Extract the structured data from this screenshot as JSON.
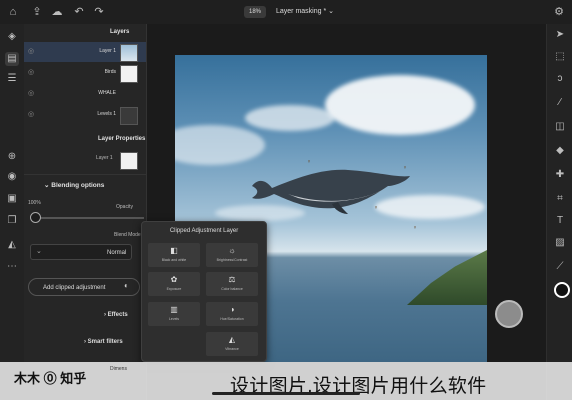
{
  "topbar": {
    "zoom": "18%",
    "title": "Layer masking",
    "title_mark": "*"
  },
  "panel": {
    "layers_title": "Layers",
    "layers": [
      {
        "name": "Layer 1",
        "thumb": "sky",
        "selected": true
      },
      {
        "name": "Birds",
        "thumb": "white",
        "selected": false
      },
      {
        "name": "WHALE",
        "thumb": "whale",
        "selected": false
      },
      {
        "name": "Levels 1",
        "thumb": "levels",
        "selected": false
      }
    ],
    "layer_props_title": "Layer Properties",
    "layer_props_name": "Layer 1",
    "blending_title": "Blending options",
    "opacity_value": "100%",
    "opacity_label": "Opacity",
    "blend_mode_label": "Blend Mode",
    "blend_mode_value": "Normal",
    "add_clipped_label": "Add clipped adjustment",
    "effects_label": "Effects",
    "smart_filters_label": "Smart filters",
    "dimensions_label": "Dimens"
  },
  "popup": {
    "title": "Clipped Adjustment Layer",
    "tiles": [
      {
        "label": "Black and white",
        "icon": "half-square-icon"
      },
      {
        "label": "Brightness/Contrast",
        "icon": "sun-icon"
      },
      {
        "label": "Exposure",
        "icon": "aperture-icon"
      },
      {
        "label": "Color balance",
        "icon": "scale-icon"
      },
      {
        "label": "Levels",
        "icon": "levels-icon"
      },
      {
        "label": "Hue/Saturation",
        "icon": "hue-icon"
      },
      {
        "label": "Vibrance",
        "icon": "vibrance-icon"
      }
    ]
  },
  "watermark": {
    "left": "木木 ⓪ 知乎",
    "right": "设计图片,设计图片用什么软件"
  }
}
